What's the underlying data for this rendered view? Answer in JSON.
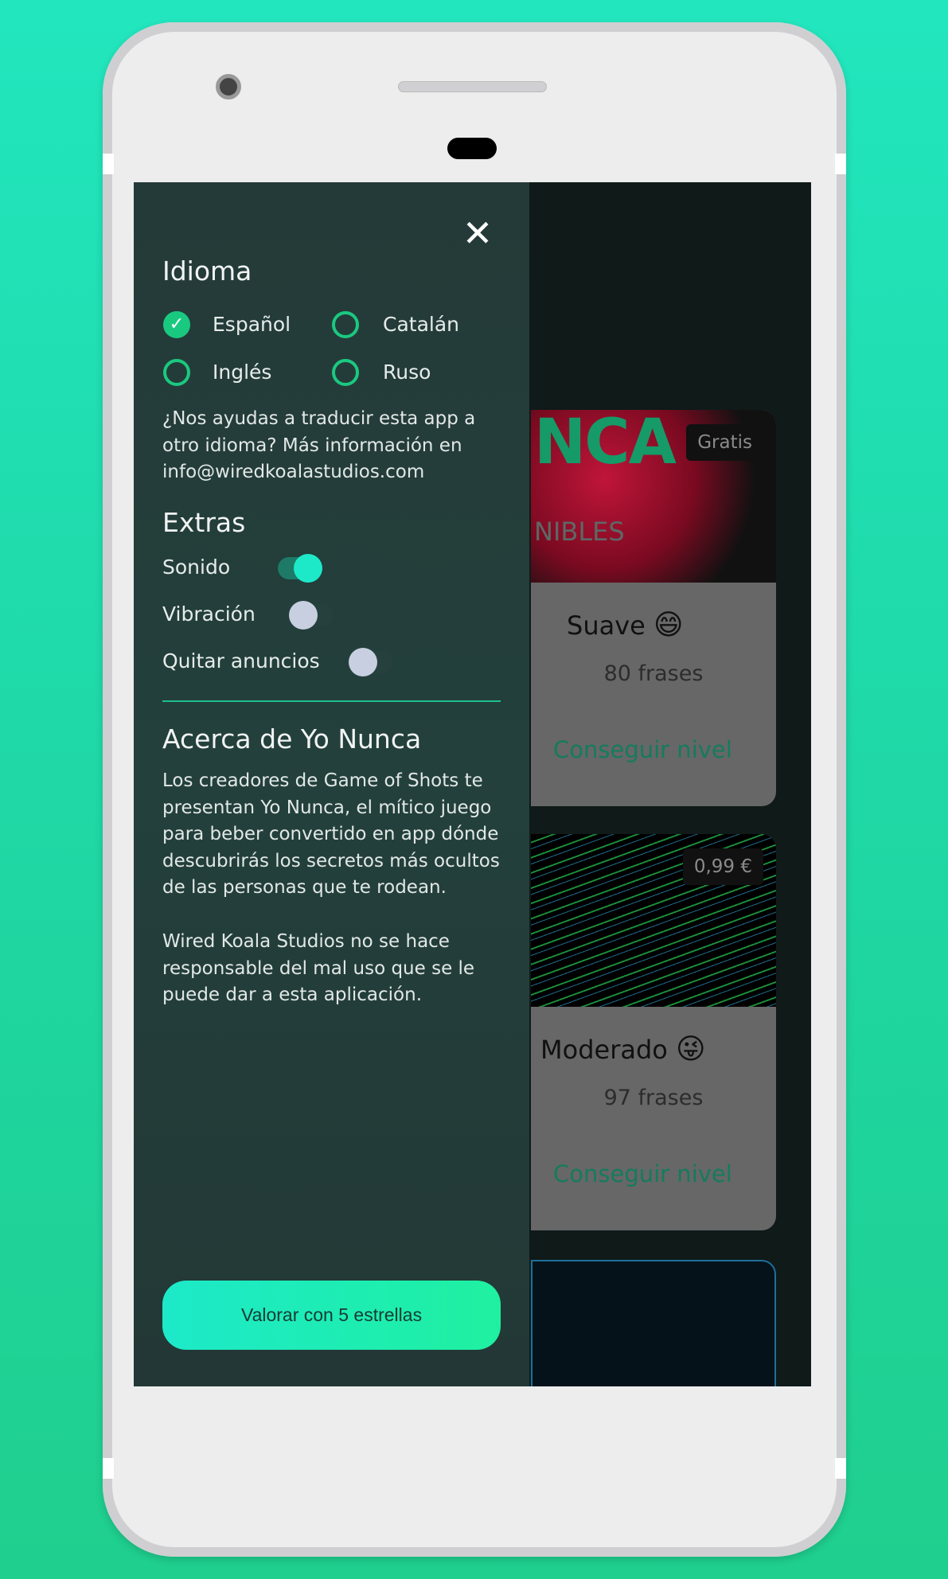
{
  "drawer": {
    "close_icon": "close-icon",
    "language": {
      "title": "Idioma",
      "options": [
        {
          "label": "Español",
          "selected": true
        },
        {
          "label": "Catalán",
          "selected": false
        },
        {
          "label": "Inglés",
          "selected": false
        },
        {
          "label": "Ruso",
          "selected": false
        }
      ],
      "help_text": "¿Nos ayudas a traducir esta app a otro idioma? Más información en info@wiredkoalastudios.com"
    },
    "extras": {
      "title": "Extras",
      "toggles": [
        {
          "label": "Sonido",
          "on": true
        },
        {
          "label": "Vibración",
          "on": false
        },
        {
          "label": "Quitar anuncios",
          "on": false
        }
      ]
    },
    "about": {
      "title": "Acerca de Yo Nunca",
      "p1": "Los creadores de Game of Shots te presentan Yo Nunca, el mítico juego para beber convertido en app dónde descubrirás los secretos más ocultos de las personas que te rodean.",
      "p2": "Wired Koala Studios no se hace responsable del mal uso que se le puede dar a esta aplicación."
    },
    "rate_button": "Valorar con 5 estrellas"
  },
  "background": {
    "logo_fragment": "NCA",
    "subtitle_fragment": "NIBLES",
    "levels": [
      {
        "badge": "Gratis",
        "title": "Suave",
        "emoji": "😄",
        "count": "80 frases",
        "action": "Conseguir nivel"
      },
      {
        "badge": "0,99 €",
        "title": "Moderado",
        "emoji": "😜",
        "count": "97 frases",
        "action": "Conseguir nivel"
      }
    ]
  },
  "colors": {
    "accent": "#1ac980",
    "toggle_on": "#1de9c9",
    "drawer_bg": "#243a38"
  }
}
